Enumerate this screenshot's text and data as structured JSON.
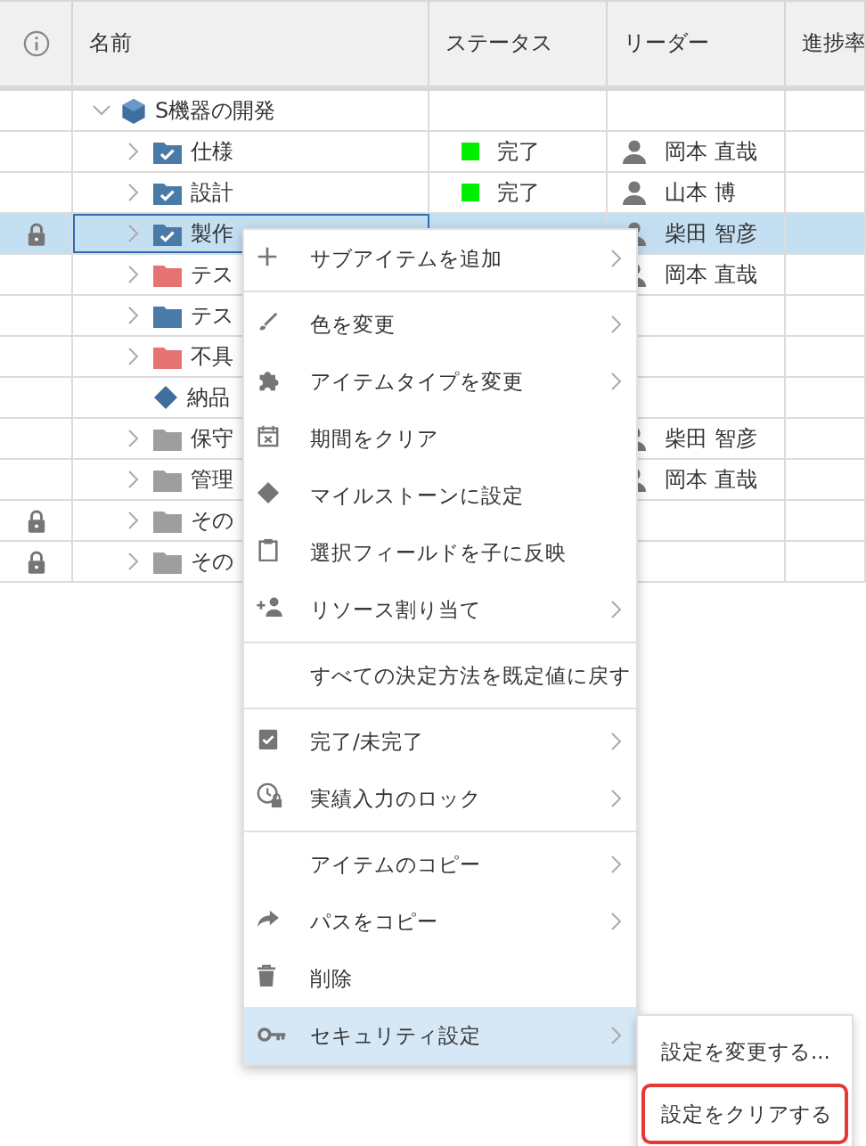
{
  "table": {
    "columns": [
      {
        "kind": "info"
      },
      {
        "kind": "text",
        "label": "名前"
      },
      {
        "kind": "text",
        "label": "ステータス"
      },
      {
        "kind": "text",
        "label": "リーダー"
      },
      {
        "kind": "text",
        "label": "進捗率"
      }
    ],
    "rows": [
      {
        "name": "S機器の開発",
        "kind": "project",
        "expandable": true,
        "expanded": true,
        "locked": false,
        "selected": false,
        "children": [
          {
            "name": "仕様",
            "kind": "task",
            "expandable": true,
            "expanded": false,
            "locked": false,
            "selected": false,
            "status": {
              "label": "完了",
              "color": "#00ee00"
            },
            "leader": "岡本 直哉"
          },
          {
            "name": "設計",
            "kind": "task",
            "expandable": true,
            "expanded": false,
            "locked": false,
            "selected": false,
            "status": {
              "label": "完了",
              "color": "#00ee00"
            },
            "leader": "山本 博"
          },
          {
            "name": "製作",
            "kind": "task",
            "expandable": true,
            "expanded": false,
            "locked": true,
            "selected": true,
            "leader": "柴田 智彦"
          },
          {
            "name": "テス",
            "kind": "folder",
            "color": "#e57373",
            "expandable": true,
            "expanded": false,
            "locked": false,
            "selected": false,
            "leader": "岡本 直哉"
          },
          {
            "name": "テス",
            "kind": "folder",
            "color": "#4a7aa8",
            "expandable": true,
            "expanded": false,
            "locked": false,
            "selected": false
          },
          {
            "name": "不具",
            "kind": "folder",
            "color": "#e57373",
            "expandable": true,
            "expanded": false,
            "locked": false,
            "selected": false
          },
          {
            "name": "納品",
            "kind": "milestone",
            "expandable": false,
            "locked": false,
            "selected": false
          },
          {
            "name": "保守",
            "kind": "folder",
            "color": "#9e9e9e",
            "expandable": true,
            "expanded": false,
            "locked": false,
            "selected": false,
            "leader": "柴田 智彦"
          },
          {
            "name": "管理",
            "kind": "folder",
            "color": "#9e9e9e",
            "expandable": true,
            "expanded": false,
            "locked": false,
            "selected": false,
            "leader": "岡本 直哉"
          },
          {
            "name": "その",
            "kind": "folder",
            "color": "#9e9e9e",
            "expandable": true,
            "expanded": false,
            "locked": true,
            "selected": false
          },
          {
            "name": "その",
            "kind": "folder",
            "color": "#9e9e9e",
            "expandable": true,
            "expanded": false,
            "locked": true,
            "selected": false
          }
        ]
      }
    ]
  },
  "context_menu": {
    "groups": [
      [
        {
          "label": "サブアイテムを追加",
          "submenu": true,
          "selected": false
        }
      ],
      [
        {
          "label": "色を変更",
          "submenu": true,
          "selected": false
        },
        {
          "label": "アイテムタイプを変更",
          "submenu": true,
          "selected": false
        },
        {
          "label": "期間をクリア",
          "submenu": false,
          "selected": false
        },
        {
          "label": "マイルストーンに設定",
          "submenu": false,
          "selected": false
        },
        {
          "label": "選択フィールドを子に反映",
          "submenu": false,
          "selected": false
        },
        {
          "label": "リソース割り当て",
          "submenu": true,
          "selected": false
        }
      ],
      [
        {
          "label": "すべての決定方法を既定値に戻す",
          "submenu": false,
          "selected": false
        }
      ],
      [
        {
          "label": "完了/未完了",
          "submenu": true,
          "selected": false
        },
        {
          "label": "実績入力のロック",
          "submenu": true,
          "selected": false
        }
      ],
      [
        {
          "label": "アイテムのコピー",
          "submenu": true,
          "selected": false
        },
        {
          "label": "パスをコピー",
          "submenu": true,
          "selected": false
        },
        {
          "label": "削除",
          "submenu": false,
          "selected": false
        },
        {
          "label": "セキュリティ設定",
          "submenu": true,
          "selected": true
        }
      ]
    ]
  },
  "submenu": {
    "items": [
      {
        "label": "設定を変更する...",
        "outlined": false
      },
      {
        "label": "設定をクリアする",
        "outlined": true
      }
    ]
  }
}
